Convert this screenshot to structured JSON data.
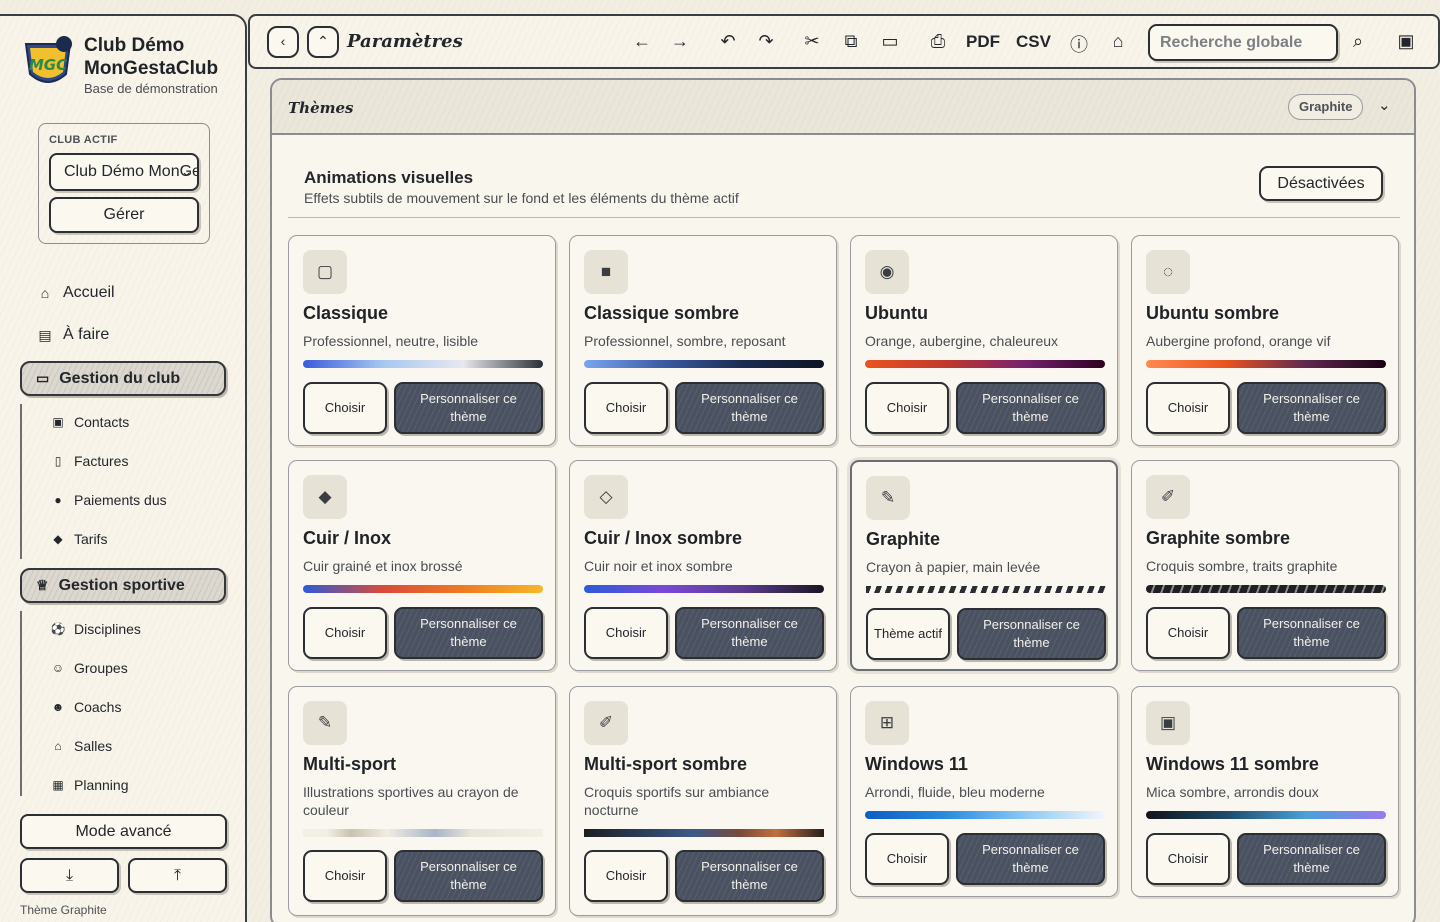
{
  "sidebar": {
    "brand_line1": "Club Démo",
    "brand_line2": "MonGestaClub",
    "brand_sub": "Base de démonstration",
    "logo_text": "MGC",
    "club_label": "CLUB ACTIF",
    "club_value": "Club Démo MonGestaClub",
    "manage_label": "Gérer",
    "nav_top": [
      {
        "label": "Accueil",
        "icon": "home-icon"
      },
      {
        "label": "À faire",
        "icon": "clipboard-icon"
      }
    ],
    "group_club": {
      "label": "Gestion du club",
      "icon": "folder-icon",
      "items": [
        {
          "label": "Contacts",
          "icon": "contact-card-icon"
        },
        {
          "label": "Factures",
          "icon": "invoice-icon"
        },
        {
          "label": "Paiements dus",
          "icon": "money-bag-icon"
        },
        {
          "label": "Tarifs",
          "icon": "price-tag-icon"
        }
      ]
    },
    "group_sport": {
      "label": "Gestion sportive",
      "icon": "trophy-icon",
      "items": [
        {
          "label": "Disciplines",
          "icon": "ball-icon"
        },
        {
          "label": "Groupes",
          "icon": "group-icon"
        },
        {
          "label": "Coachs",
          "icon": "coach-icon"
        },
        {
          "label": "Salles",
          "icon": "building-icon"
        },
        {
          "label": "Planning",
          "icon": "calendar-icon"
        }
      ]
    },
    "mode_label": "Mode avancé",
    "theme_footer": "Thème Graphite"
  },
  "toolbar": {
    "title": "Paramètres",
    "pdf_label": "PDF",
    "csv_label": "CSV",
    "search_placeholder": "Recherche globale"
  },
  "panel": {
    "title": "Thèmes",
    "current_theme_badge": "Graphite",
    "animations_title": "Animations visuelles",
    "animations_desc": "Effets subtils de mouvement sur le fond et les éléments du thème actif",
    "animations_button": "Désactivées"
  },
  "themes": [
    {
      "name": "Classique",
      "desc": "Professionnel, neutre, lisible",
      "icon": "square-outline-icon",
      "choose": "Choisir",
      "custom": "Personnaliser ce thème"
    },
    {
      "name": "Classique sombre",
      "desc": "Professionnel, sombre, reposant",
      "icon": "square-filled-icon",
      "choose": "Choisir",
      "custom": "Personnaliser ce thème"
    },
    {
      "name": "Ubuntu",
      "desc": "Orange, aubergine, chaleureux",
      "icon": "radio-dot-icon",
      "choose": "Choisir",
      "custom": "Personnaliser ce thème"
    },
    {
      "name": "Ubuntu sombre",
      "desc": "Aubergine profond, orange vif",
      "icon": "dashed-circle-icon",
      "choose": "Choisir",
      "custom": "Personnaliser ce thème"
    },
    {
      "name": "Cuir / Inox",
      "desc": "Cuir grainé et inox brossé",
      "icon": "diamond-filled-icon",
      "choose": "Choisir",
      "custom": "Personnaliser ce thème"
    },
    {
      "name": "Cuir / Inox sombre",
      "desc": "Cuir noir et inox sombre",
      "icon": "diamond-outline-icon",
      "choose": "Choisir",
      "custom": "Personnaliser ce thème"
    },
    {
      "name": "Graphite",
      "desc": "Crayon à papier, main levée",
      "icon": "pencil-icon",
      "choose": "Thème actif",
      "custom": "Personnaliser ce thème"
    },
    {
      "name": "Graphite sombre",
      "desc": "Croquis sombre, traits graphite",
      "icon": "eraser-icon",
      "choose": "Choisir",
      "custom": "Personnaliser ce thème"
    },
    {
      "name": "Multi-sport",
      "desc": "Illustrations sportives au crayon de couleur",
      "icon": "pencil-icon",
      "choose": "Choisir",
      "custom": "Personnaliser ce thème"
    },
    {
      "name": "Multi-sport sombre",
      "desc": "Croquis sportifs sur ambiance nocturne",
      "icon": "eraser-icon",
      "choose": "Choisir",
      "custom": "Personnaliser ce thème"
    },
    {
      "name": "Windows 11",
      "desc": "Arrondi, fluide, bleu moderne",
      "icon": "windows-grid-icon",
      "choose": "Choisir",
      "custom": "Personnaliser ce thème"
    },
    {
      "name": "Windows 11 sombre",
      "desc": "Mica sombre, arrondis doux",
      "icon": "square-inset-icon",
      "choose": "Choisir",
      "custom": "Personnaliser ce thème"
    }
  ],
  "colors": {
    "ink": "#23262b",
    "paper": "#f3eee2",
    "button_dark": "#4a5262"
  }
}
